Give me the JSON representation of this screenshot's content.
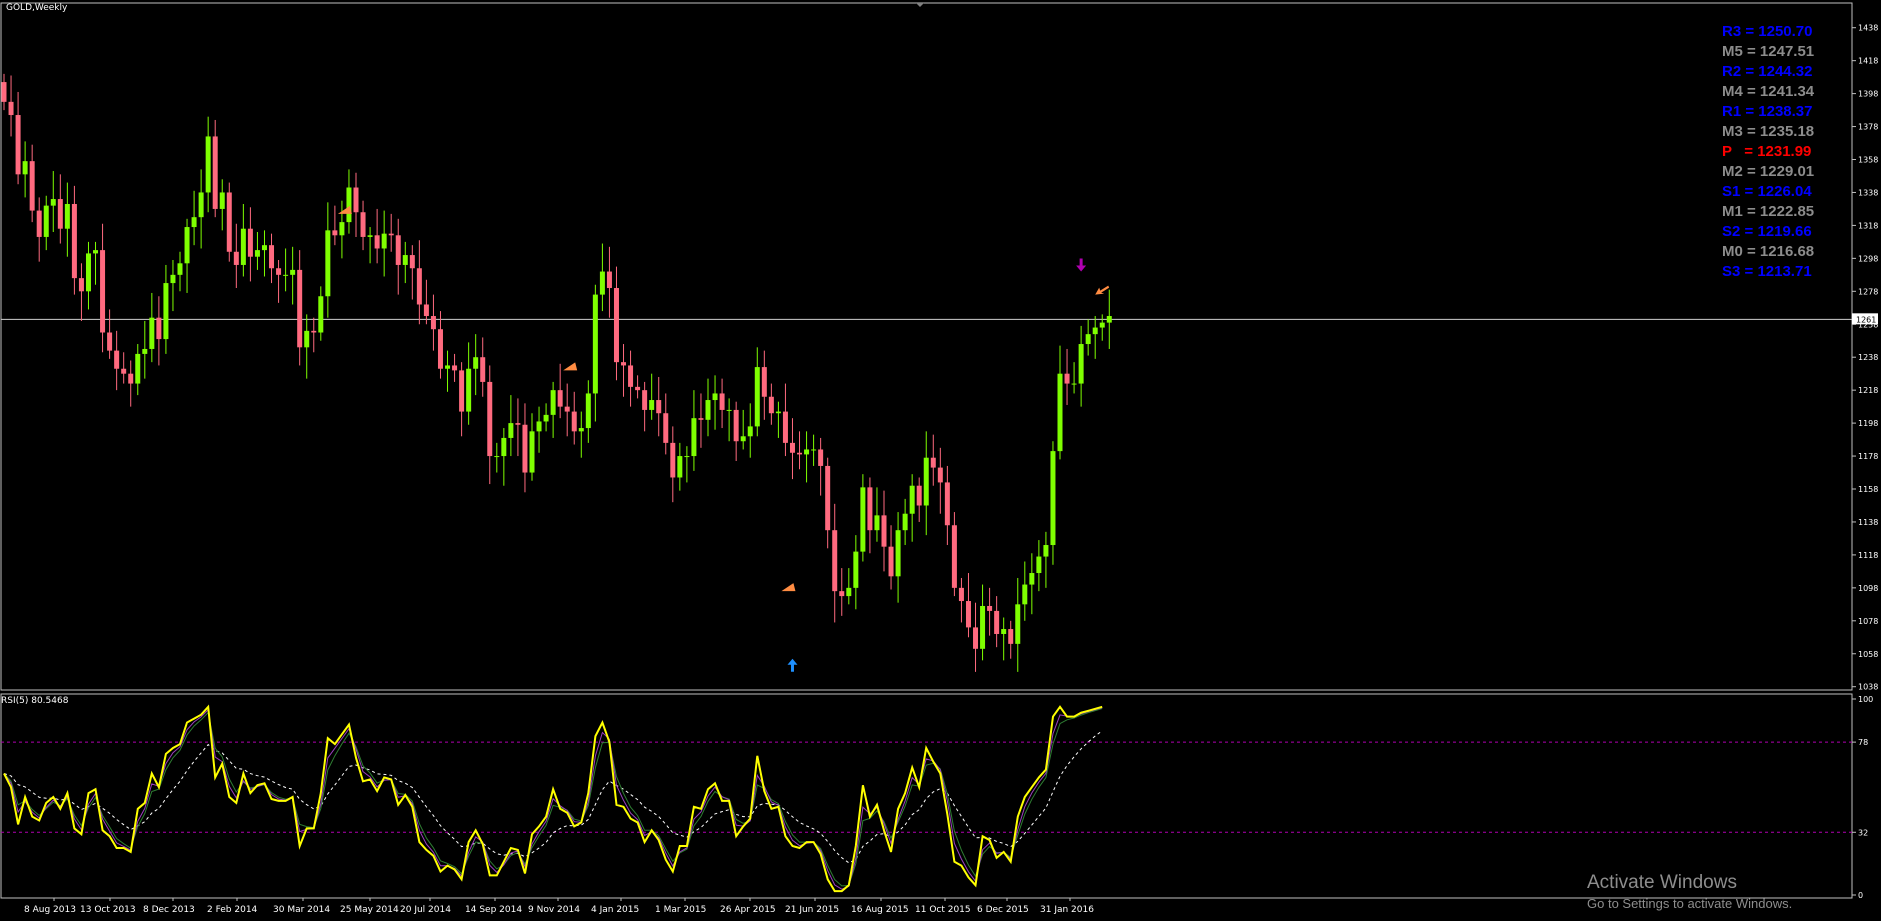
{
  "window": {
    "title": "GOLD,Weekly",
    "indicator_label": "RSI(5) 80.5468",
    "current_price_label": "1261"
  },
  "pivot_levels": [
    {
      "label": "R3 = 1250.70",
      "color": "#0000ff"
    },
    {
      "label": "M5 = 1247.51",
      "color": "#8c8c8c"
    },
    {
      "label": "R2 = 1244.32",
      "color": "#0000ff"
    },
    {
      "label": "M4 = 1241.34",
      "color": "#8c8c8c"
    },
    {
      "label": "R1 = 1238.37",
      "color": "#0000ff"
    },
    {
      "label": "M3 = 1235.18",
      "color": "#8c8c8c"
    },
    {
      "label": "P   = 1231.99",
      "color": "#ff0000"
    },
    {
      "label": "M2 = 1229.01",
      "color": "#8c8c8c"
    },
    {
      "label": "S1 = 1226.04",
      "color": "#0000ff"
    },
    {
      "label": "M1 = 1222.85",
      "color": "#8c8c8c"
    },
    {
      "label": "S2 = 1219.66",
      "color": "#0000ff"
    },
    {
      "label": "M0 = 1216.68",
      "color": "#8c8c8c"
    },
    {
      "label": "S3 = 1213.71",
      "color": "#0000ff"
    }
  ],
  "watermark": {
    "line1": "Activate Windows",
    "line2": "Go to Settings to activate Windows."
  },
  "colors": {
    "bull": "#7fff00",
    "bear": "#ff6a7f",
    "rsi": "#ffff00",
    "rsi_signal_1": "#9b3fbf",
    "rsi_signal_2": "#2e7d32",
    "levels_line": "#b000b0"
  },
  "chart_data": [
    {
      "type": "candlestick",
      "title": "GOLD,Weekly",
      "y_ticks": [
        1438,
        1418,
        1398,
        1378,
        1358,
        1338,
        1318,
        1298,
        1278,
        1258,
        1238,
        1218,
        1198,
        1178,
        1158,
        1138,
        1118,
        1098,
        1078,
        1058,
        1038
      ],
      "ylim": [
        1036,
        1453
      ],
      "x_ticks": [
        "8 Aug 2013",
        "13 Oct 2013",
        "8 Dec 2013",
        "2 Feb 2014",
        "30 Mar 2014",
        "25 May 2014",
        "20 Jul 2014",
        "14 Sep 2014",
        "9 Nov 2014",
        "4 Jan 2015",
        "1 Mar 2015",
        "26 Apr 2015",
        "21 Jun 2015",
        "16 Aug 2015",
        "11 Oct 2015",
        "6 Dec 2015",
        "31 Jan 2016"
      ],
      "current_price": 1261,
      "closes": [
        1393,
        1385,
        1349,
        1357,
        1327,
        1311,
        1330,
        1334,
        1316,
        1331,
        1286,
        1278,
        1301,
        1303,
        1253,
        1242,
        1231,
        1228,
        1222,
        1240,
        1243,
        1262,
        1249,
        1283,
        1288,
        1295,
        1317,
        1323,
        1338,
        1372,
        1328,
        1338,
        1302,
        1294,
        1316,
        1299,
        1303,
        1306,
        1292,
        1288,
        1288,
        1291,
        1244,
        1254,
        1253,
        1275,
        1315,
        1312,
        1320,
        1341,
        1326,
        1311,
        1312,
        1304,
        1313,
        1312,
        1294,
        1300,
        1292,
        1270,
        1263,
        1255,
        1231,
        1233,
        1230,
        1205,
        1231,
        1238,
        1223,
        1178,
        1178,
        1189,
        1198,
        1197,
        1168,
        1193,
        1199,
        1203,
        1218,
        1208,
        1205,
        1193,
        1195,
        1216,
        1276,
        1290,
        1280,
        1235,
        1233,
        1220,
        1218,
        1206,
        1212,
        1204,
        1186,
        1165,
        1178,
        1178,
        1201,
        1200,
        1212,
        1216,
        1206,
        1206,
        1187,
        1190,
        1196,
        1232,
        1214,
        1204,
        1205,
        1186,
        1180,
        1179,
        1182,
        1182,
        1172,
        1133,
        1096,
        1093,
        1098,
        1120,
        1159,
        1133,
        1142,
        1123,
        1105,
        1133,
        1143,
        1160,
        1148,
        1177,
        1171,
        1162,
        1136,
        1098,
        1090,
        1074,
        1061,
        1087,
        1084,
        1070,
        1073,
        1064,
        1088,
        1100,
        1107,
        1117,
        1124,
        1181,
        1228,
        1222,
        1222,
        1246,
        1252,
        1256,
        1259,
        1263
      ]
    },
    {
      "type": "line",
      "title": "RSI(5) 80.5468",
      "y_ticks": [
        100,
        78,
        32,
        0
      ],
      "ylim": [
        0,
        100
      ],
      "levels": [
        78,
        32
      ],
      "series": [
        {
          "name": "RSI(5) 80.5468",
          "values": [
            62,
            55,
            36,
            50,
            40,
            38,
            47,
            50,
            44,
            52,
            34,
            31,
            52,
            54,
            33,
            30,
            24,
            24,
            22,
            44,
            47,
            62,
            55,
            72,
            75,
            77,
            88,
            90,
            92,
            96,
            60,
            67,
            50,
            47,
            62,
            52,
            56,
            57,
            49,
            48,
            48,
            50,
            25,
            34,
            34,
            52,
            80,
            77,
            82,
            87,
            70,
            58,
            59,
            53,
            60,
            59,
            46,
            51,
            45,
            27,
            23,
            20,
            12,
            15,
            13,
            8,
            27,
            33,
            26,
            10,
            10,
            17,
            24,
            23,
            11,
            31,
            35,
            40,
            54,
            44,
            42,
            35,
            37,
            52,
            81,
            88,
            78,
            46,
            45,
            39,
            37,
            27,
            33,
            28,
            18,
            12,
            25,
            25,
            45,
            44,
            54,
            57,
            48,
            48,
            30,
            35,
            39,
            71,
            53,
            44,
            45,
            30,
            25,
            24,
            27,
            27,
            21,
            8,
            2,
            2,
            5,
            25,
            56,
            40,
            46,
            33,
            22,
            44,
            52,
            65,
            55,
            75,
            68,
            62,
            41,
            17,
            15,
            9,
            5,
            30,
            28,
            19,
            22,
            17,
            40,
            50,
            55,
            60,
            64,
            91,
            96,
            91,
            91,
            93,
            94,
            95,
            96
          ]
        }
      ]
    }
  ]
}
